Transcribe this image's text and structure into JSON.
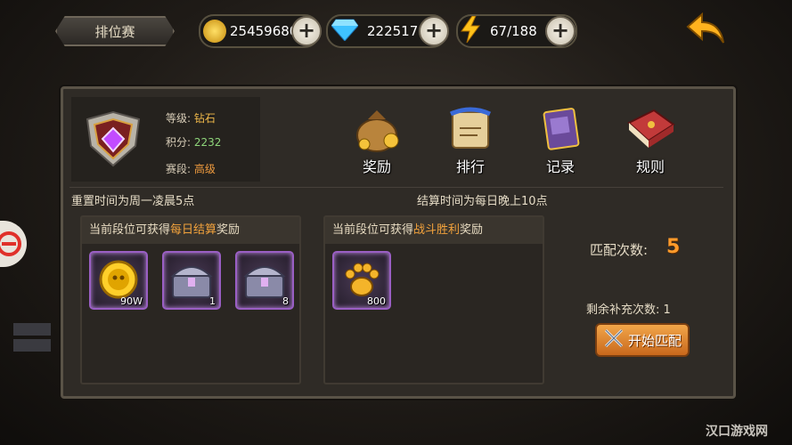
{
  "header": {
    "title": "排位赛",
    "gold": "25459680",
    "diamonds": "222517",
    "energy": "67/188"
  },
  "profile": {
    "level_label": "等级:",
    "level_value": "钻石",
    "points_label": "积分:",
    "points_value": "2232",
    "segment_label": "赛段:",
    "segment_value": "高级"
  },
  "menu": [
    {
      "label": "奖励",
      "icon": "reward-bag-icon"
    },
    {
      "label": "排行",
      "icon": "ranking-scroll-icon"
    },
    {
      "label": "记录",
      "icon": "record-book-icon"
    },
    {
      "label": "规则",
      "icon": "rules-book-icon"
    }
  ],
  "notes": {
    "reset_time": "重置时间为周一凌晨5点",
    "settle_time": "结算时间为每日晚上10点"
  },
  "daily_reward": {
    "prefix": "当前段位可获得",
    "highlight": "每日结算",
    "suffix": "奖励",
    "items": [
      {
        "icon": "gold-coin-icon",
        "count": "90W"
      },
      {
        "icon": "silver-chest-icon",
        "count": "1"
      },
      {
        "icon": "silver-chest-icon",
        "count": "8"
      }
    ]
  },
  "battle_reward": {
    "prefix": "当前段位可获得",
    "highlight": "战斗胜利",
    "suffix": "奖励",
    "items": [
      {
        "icon": "paw-token-icon",
        "count": "800"
      }
    ]
  },
  "match": {
    "count_label": "匹配次数:",
    "count_value": "5",
    "refill_label": "剩余补充次数: 1",
    "start_button": "开始匹配"
  },
  "watermark": "汉口游戏网",
  "colors": {
    "accent_orange": "#f2a23c",
    "diamond_text": "#f0b94a",
    "points_green": "#8ed57a",
    "item_border": "#9a5fc4"
  }
}
